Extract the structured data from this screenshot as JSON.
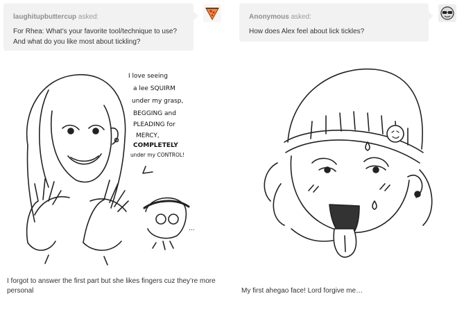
{
  "posts": [
    {
      "asker": "laughitupbuttercup",
      "asked_label": "asked:",
      "question": "For Rhea: What’s your favorite tool/technique to use? And what do you like most about tickling?",
      "avatar_icon": "pizza-slice-icon",
      "comic_text": [
        "I love seeing",
        "a lee SQUIRM",
        "under my grasp,",
        "BEGGING and",
        "PLEADING for",
        "MERCY,",
        "COMPLETELY",
        "under my CONTROL!"
      ],
      "comic_small": "...",
      "caption": "I forgot to answer the first part but she likes fingers cuz they’re more personal"
    },
    {
      "asker": "Anonymous",
      "asked_label": "asked:",
      "question": "How does Alex feel about lick tickles?",
      "avatar_icon": "sunglasses-face-icon",
      "caption": "My first ahegao face! Lord forgive me…"
    }
  ],
  "colors": {
    "bubble_bg": "#f2f2f2",
    "avatar_left_bg": "#f07a3a",
    "avatar_right_bg": "#eeeeee"
  }
}
